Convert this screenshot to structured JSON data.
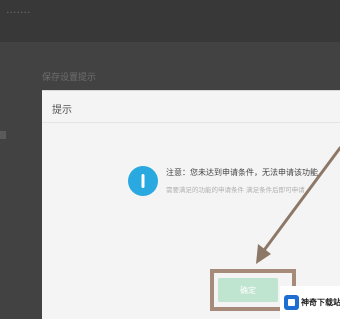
{
  "background": {
    "top_text": "·······",
    "section_title": "保存设置提示"
  },
  "dialog": {
    "title": "提示",
    "message": "注意：您未达到申请条件，无法申请该功能",
    "detail": "需要满足的功能的申请条件    满足条件后即可申请",
    "confirm_label": "确定",
    "icon": "info-icon"
  },
  "watermark": {
    "text": "神奇下载站",
    "logo": "site-logo"
  },
  "colors": {
    "info_blue": "#2aa8e0",
    "button_green": "#bfe4cf",
    "arrow": "#8d7868",
    "highlight": "#a68a7a"
  }
}
